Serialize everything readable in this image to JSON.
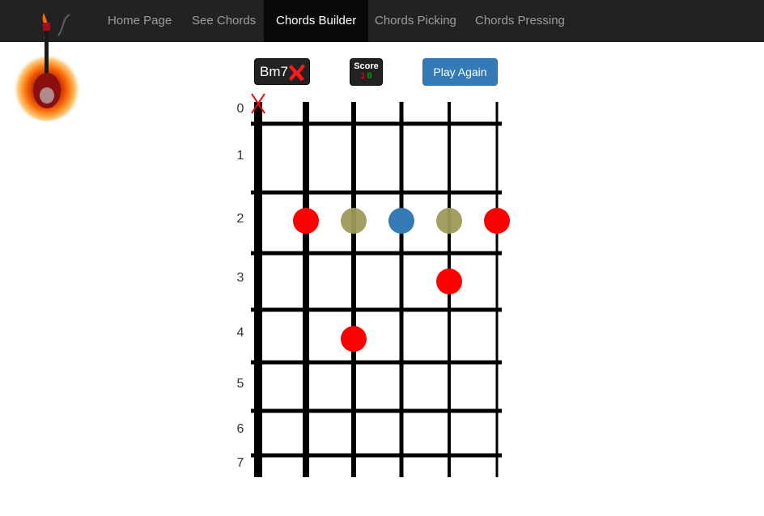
{
  "nav": {
    "items": [
      {
        "label": "Home Page",
        "active": false
      },
      {
        "label": "See Chords",
        "active": false
      },
      {
        "label": "Chords Builder",
        "active": true
      },
      {
        "label": "Chords Picking",
        "active": false
      },
      {
        "label": "Chords Pressing",
        "active": false
      }
    ]
  },
  "logo": {
    "icon": "flaming-guitar-logo"
  },
  "chord": {
    "name": "Bm7",
    "status_icon": "red-x-icon",
    "status": "incorrect"
  },
  "score": {
    "label": "Score",
    "wrong": "1",
    "right": "0"
  },
  "play_again": {
    "label": "Play Again"
  },
  "fretboard": {
    "fret_labels": [
      "0",
      "1",
      "2",
      "3",
      "4",
      "5",
      "6",
      "7"
    ],
    "strings": 6,
    "muted_strings": [
      1
    ],
    "colors": {
      "red": "#ff0000",
      "olive": "#9c9a5a",
      "blue": "#337ab7",
      "mute": "#ff0000"
    },
    "dots": [
      {
        "string": 2,
        "fret": 2,
        "color": "red"
      },
      {
        "string": 3,
        "fret": 2,
        "color": "olive"
      },
      {
        "string": 4,
        "fret": 2,
        "color": "blue"
      },
      {
        "string": 5,
        "fret": 2,
        "color": "olive"
      },
      {
        "string": 6,
        "fret": 2,
        "color": "red"
      },
      {
        "string": 5,
        "fret": 3,
        "color": "red"
      },
      {
        "string": 3,
        "fret": 4,
        "color": "red"
      }
    ]
  }
}
